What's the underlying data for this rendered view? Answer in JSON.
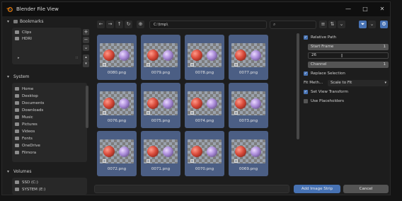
{
  "window": {
    "title": "Blender File View"
  },
  "bookmarks": {
    "header": "Bookmarks",
    "items": [
      {
        "label": "Clips"
      },
      {
        "label": "HDRI"
      }
    ]
  },
  "system": {
    "header": "System",
    "items": [
      {
        "label": "Home"
      },
      {
        "label": "Desktop"
      },
      {
        "label": "Documents"
      },
      {
        "label": "Downloads"
      },
      {
        "label": "Music"
      },
      {
        "label": "Pictures"
      },
      {
        "label": "Videos"
      },
      {
        "label": "Fonts"
      },
      {
        "label": "OneDrive"
      },
      {
        "label": "Filmora"
      }
    ]
  },
  "volumes": {
    "header": "Volumes",
    "items": [
      {
        "label": "SSD (C:)"
      },
      {
        "label": "SYSTEM (E:)"
      }
    ]
  },
  "toolbar": {
    "path": "C:\\tmp\\",
    "search_placeholder": ""
  },
  "files": [
    {
      "name": "0080.png"
    },
    {
      "name": "0079.png"
    },
    {
      "name": "0078.png"
    },
    {
      "name": "0077.png"
    },
    {
      "name": "0076.png"
    },
    {
      "name": "0075.png"
    },
    {
      "name": "0074.png"
    },
    {
      "name": "0073.png"
    },
    {
      "name": "0072.png"
    },
    {
      "name": "0071.png"
    },
    {
      "name": "0070.png"
    },
    {
      "name": "0069.png"
    }
  ],
  "options": {
    "relative_path": {
      "label": "Relative Path",
      "checked": true
    },
    "start_frame": {
      "label": "Start Frame",
      "value": "1"
    },
    "start_frame_edit": "26",
    "channel": {
      "label": "Channel",
      "value": "1"
    },
    "replace_selection": {
      "label": "Replace Selection",
      "checked": true
    },
    "fit_method": {
      "label": "Fit Meth...",
      "value": "Scale to Fit"
    },
    "set_view_transform": {
      "label": "Set View Transform",
      "checked": true
    },
    "use_placeholders": {
      "label": "Use Placeholders",
      "checked": false
    }
  },
  "footer": {
    "primary_label": "Add Image Strip",
    "cancel_label": "Cancel"
  },
  "colors": {
    "accent": "#4772b3",
    "tile": "#4b5e84",
    "background": "#1d1d1d"
  }
}
